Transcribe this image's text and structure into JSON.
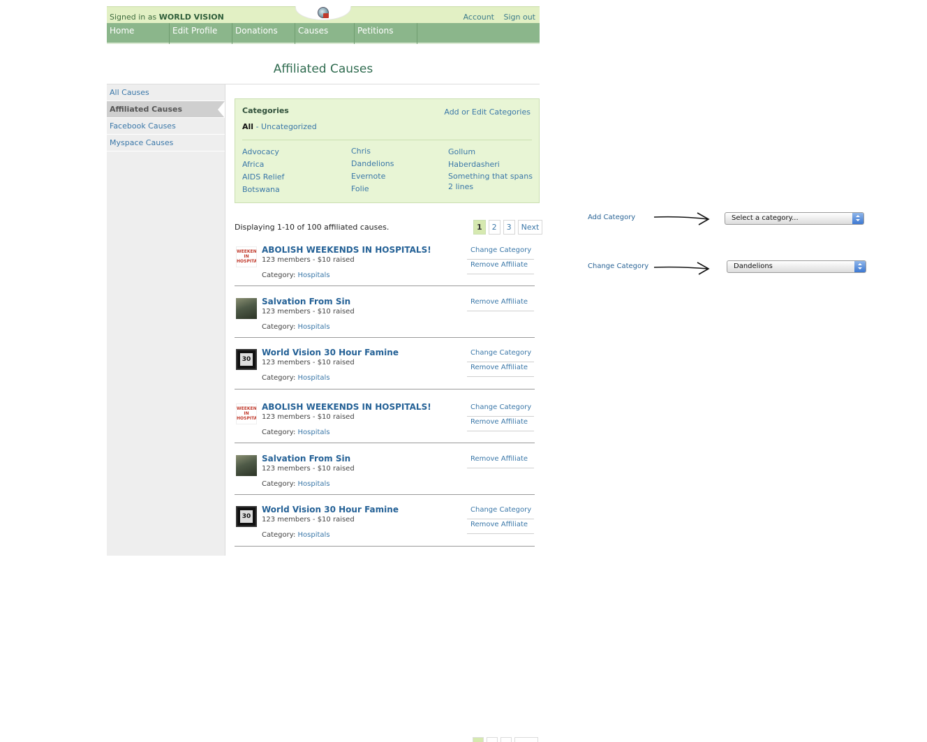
{
  "header": {
    "signed_in_prefix": "Signed in as",
    "org_name": "WORLD VISION",
    "account": "Account",
    "sign_out": "Sign out"
  },
  "nav": [
    "Home",
    "Edit Profile",
    "Donations",
    "Causes",
    "Petitions"
  ],
  "page_title": "Affiliated Causes",
  "sidebar": [
    "All Causes",
    "Affiliated Causes",
    "Facebook Causes",
    "Myspace Causes"
  ],
  "categories": {
    "title": "Categories",
    "edit_link": "Add or Edit Categories",
    "all": "All",
    "sep": "-",
    "uncategorized": "Uncategorized",
    "col1": [
      "Advocacy",
      "Africa",
      "AIDS Relief",
      "Botswana"
    ],
    "col2": [
      "Chris",
      "Dandelions",
      "Evernote",
      "Folie"
    ],
    "col3": [
      "Gollum",
      "Haberdasheri",
      "Something that spans 2 lines"
    ]
  },
  "listing": {
    "displaying": "Displaying 1-10 of 100 affiliated causes.",
    "pages": [
      "1",
      "2",
      "3"
    ],
    "next": "Next"
  },
  "cause_labels": {
    "category_label": "Category:",
    "change_category": "Change Category",
    "remove_affiliate": "Remove Affiliate"
  },
  "causes": [
    {
      "name": "ABOLISH WEEKENDS IN HOSPITALS!",
      "stats": "123 members - $10 raised",
      "category": "Hospitals",
      "thumb_text": "WEEKENDS IN HOSPITAL"
    },
    {
      "name": "Salvation From Sin",
      "stats": "123 members - $10 raised",
      "category": "Hospitals"
    },
    {
      "name": "World Vision 30 Hour Famine",
      "stats": "123 members - $10 raised",
      "category": "Hospitals"
    },
    {
      "name": "ABOLISH WEEKENDS IN HOSPITALS!",
      "stats": "123 members - $10 raised",
      "category": "Hospitals",
      "thumb_text": "WEEKENDS IN HOSPITAL"
    },
    {
      "name": "Salvation From Sin",
      "stats": "123 members - $10 raised",
      "category": "Hospitals"
    },
    {
      "name": "World Vision 30 Hour Famine",
      "stats": "123 members - $10 raised",
      "category": "Hospitals"
    }
  ],
  "annotations": {
    "add_category_label": "Add Category",
    "add_category_select": "Select a category...",
    "change_category_label": "Change Category",
    "change_category_select": "Dandelions"
  },
  "colors": {
    "topbar": "#e2f0c4",
    "nav": "#8bb68b",
    "link": "#2a6496",
    "category_box": "#e8f5d5"
  }
}
